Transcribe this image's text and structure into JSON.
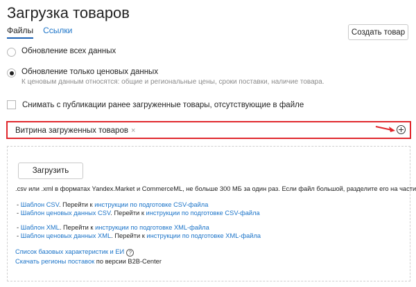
{
  "page": {
    "title": "Загрузка товаров"
  },
  "tabs": [
    {
      "label": "Файлы",
      "active": true
    },
    {
      "label": "Ссылки",
      "active": false
    }
  ],
  "header": {
    "create_button": "Создать товар"
  },
  "update_options": [
    {
      "label": "Обновление всех данных",
      "checked": false
    },
    {
      "label": "Обновление только ценовых данных",
      "checked": true,
      "hint": "К ценовым данным относятся: общие и региональные цены, сроки поставки, наличие товара."
    }
  ],
  "unpublish_checkbox": {
    "label": "Снимать с публикации ранее загруженные товары, отсутствующие в файле",
    "checked": false
  },
  "showcase": {
    "tag": "Витрина загруженных товаров",
    "remove_glyph": "×"
  },
  "upload": {
    "button": "Загрузить",
    "formats": ".csv или .xml в форматах Yandex.Market и CommerceML, не больше 300 МБ за один раз. Если файл большой, разделите его на части.",
    "csv_template_prefix": "- ",
    "csv_template_link": "Шаблон CSV",
    "csv_template_goto": ". Перейти к ",
    "csv_template_guide": "инструкции по подготовке CSV-файла",
    "csv_price_prefix": "- ",
    "csv_price_link": "Шаблон ценовых данных CSV",
    "csv_price_goto": ". Перейти к ",
    "csv_price_guide": "инструкции по подготовке CSV-файла",
    "xml_template_prefix": "- ",
    "xml_template_link": "Шаблон XML",
    "xml_template_goto": ". Перейти к ",
    "xml_template_guide": "инструкции по подготовке XML-файла",
    "xml_price_prefix": "- ",
    "xml_price_link": "Шаблон ценовых данных XML",
    "xml_price_goto": ". Перейти к ",
    "xml_price_guide": "инструкции по подготовке XML-файла",
    "characteristics_link": "Список базовых характеристик и ЕИ",
    "help_glyph": "?",
    "regions_link": "Скачать регионы поставок",
    "regions_suffix": " по версии B2B-Center"
  },
  "colors": {
    "accent_link": "#1a73c8",
    "highlight": "#e0262b"
  }
}
